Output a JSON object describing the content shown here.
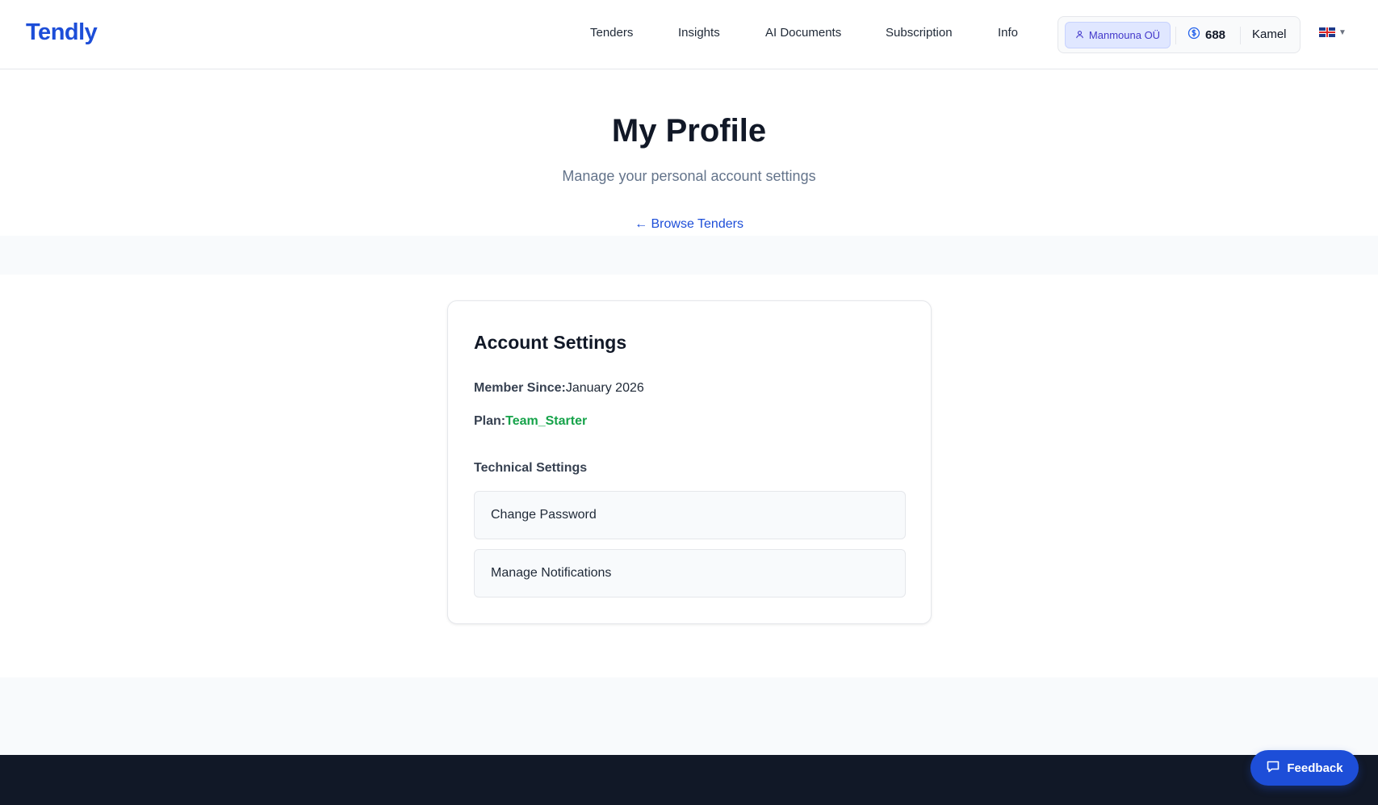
{
  "brand": {
    "name": "Tendly"
  },
  "nav": {
    "items": [
      {
        "label": "Tenders"
      },
      {
        "label": "Insights"
      },
      {
        "label": "AI Documents"
      },
      {
        "label": "Subscription"
      },
      {
        "label": "Info"
      }
    ]
  },
  "user": {
    "organization": "Manmouna OÜ",
    "credits": "688",
    "name": "Kamel",
    "language_icon": "uk-flag-icon"
  },
  "hero": {
    "title": "My Profile",
    "subtitle": "Manage your personal account settings",
    "back_link": "← Browse Tenders"
  },
  "account": {
    "title": "Account Settings",
    "member_since_label": "Member Since:",
    "member_since_value": "January 2026",
    "plan_label": "Plan:",
    "plan_value": "Team_Starter",
    "technical_title": "Technical Settings",
    "change_password": "Change Password",
    "manage_notifications": "Manage Notifications"
  },
  "feedback": {
    "label": "Feedback"
  },
  "colors": {
    "brand": "#1d4ed8",
    "plan_green": "#16a34a",
    "org_badge_bg": "#e0e7ff",
    "footer_bg": "#111827"
  }
}
